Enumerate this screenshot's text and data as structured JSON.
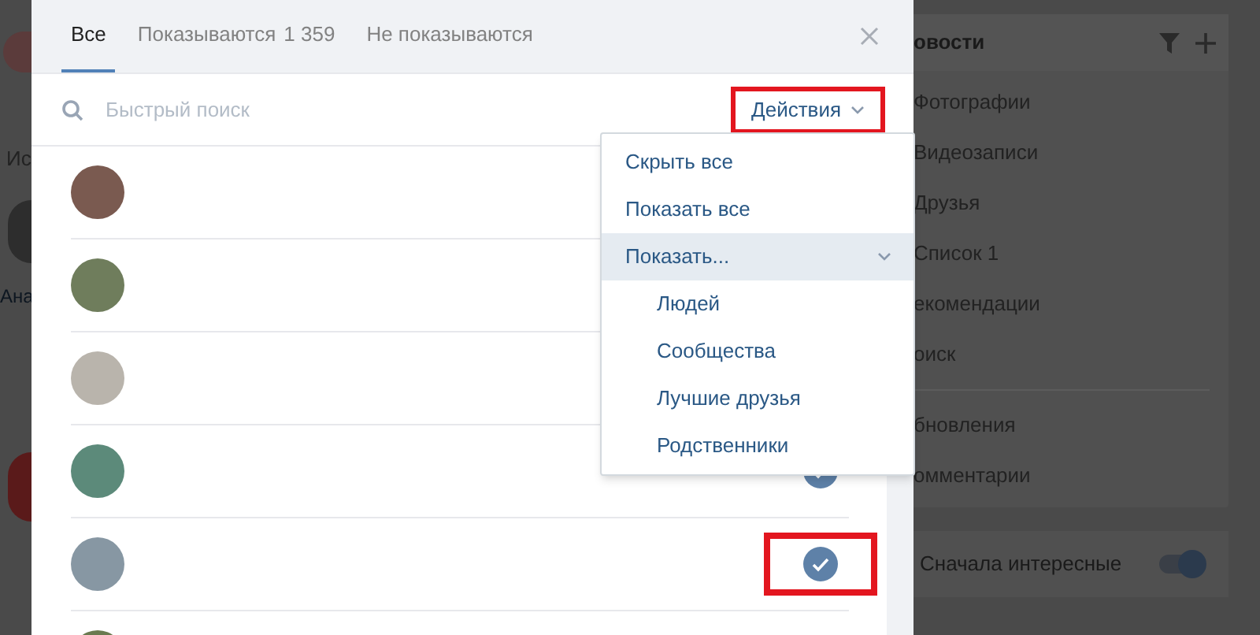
{
  "background_page": {
    "left_texts": [
      "Ис",
      "Ана"
    ],
    "news_card": {
      "title": "овости",
      "items": [
        "Фотографии",
        "Видеозаписи",
        "Друзья",
        "Список 1",
        "екомендации",
        "оиск"
      ],
      "items_2": [
        "бновления",
        "омментарии"
      ]
    },
    "sort_toggle": {
      "label": "Сначала интересные",
      "on": true
    }
  },
  "modal": {
    "tabs": [
      {
        "label": "Все",
        "selected": true
      },
      {
        "label": "Показываются",
        "count": "1 359",
        "selected": false
      },
      {
        "label": "Не показываются",
        "selected": false
      }
    ],
    "search": {
      "placeholder": "Быстрый поиск"
    },
    "actions_button": {
      "label": "Действия",
      "highlighted": true
    },
    "rows": [
      {},
      {},
      {},
      {
        "checked": true
      },
      {
        "checked": true,
        "highlighted": true
      },
      {}
    ],
    "actions_menu": [
      {
        "kind": "item",
        "label": "Скрыть все",
        "selected": false
      },
      {
        "kind": "item",
        "label": "Показать все",
        "selected": false
      },
      {
        "kind": "group",
        "label": "Показать...",
        "selected": true
      },
      {
        "kind": "subitem",
        "label": "Людей",
        "selected": false
      },
      {
        "kind": "subitem",
        "label": "Сообщества",
        "selected": false
      },
      {
        "kind": "subitem",
        "label": "Лучшие друзья",
        "selected": false
      },
      {
        "kind": "subitem",
        "label": "Родственники",
        "selected": false
      }
    ]
  }
}
